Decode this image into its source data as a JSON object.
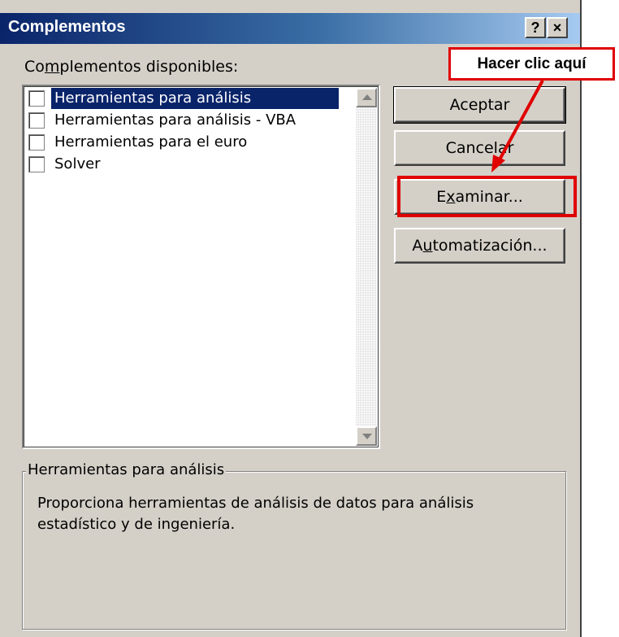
{
  "dialog": {
    "title": "Complementos",
    "help_label": "?",
    "close_label": "×"
  },
  "addins": {
    "label_prefix": "Co",
    "label_accel": "m",
    "label_suffix": "plementos disponibles:",
    "items": [
      {
        "label": "Herramientas para análisis",
        "checked": false,
        "selected": true
      },
      {
        "label": "Herramientas para análisis - VBA",
        "checked": false,
        "selected": false
      },
      {
        "label": "Herramientas para el euro",
        "checked": false,
        "selected": false
      },
      {
        "label": "Solver",
        "checked": false,
        "selected": false
      }
    ]
  },
  "buttons": {
    "ok": "Aceptar",
    "cancel": "Cancelar",
    "browse_prefix": "E",
    "browse_accel": "x",
    "browse_suffix": "aminar...",
    "automation_prefix": "A",
    "automation_accel": "u",
    "automation_suffix": "tomatización..."
  },
  "description": {
    "legend": "Herramientas para análisis",
    "text": "Proporciona herramientas de análisis de datos para análisis estadístico y de ingeniería."
  },
  "annotation": {
    "callout": "Hacer clic aquí",
    "color": "#e00000"
  },
  "colors": {
    "face": "#d4d0c8",
    "title_start": "#0a246a",
    "selection": "#0a246a"
  }
}
